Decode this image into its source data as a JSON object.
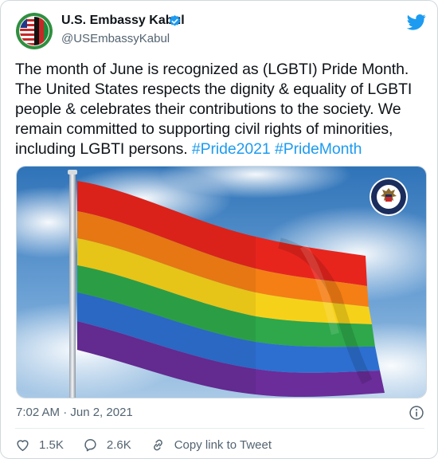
{
  "tweet": {
    "author_name": "U.S. Embassy Kabul",
    "author_handle": "@USEmbassyKabul",
    "text_main": "The month of June is recognized as (LGBTI) Pride Month. The United States respects the dignity & equality of LGBTI people & celebrates their contributions to the society. We remain committed to supporting civil rights of minorities, including LGBTI persons.",
    "hashtag_1": "#Pride2021",
    "hashtag_2": "#PrideMonth",
    "timestamp": "7:02 AM · Jun 2, 2021",
    "likes": "1.5K",
    "replies": "2.6K",
    "share_label": "Copy link to Tweet"
  },
  "icons": {
    "verified": "verified-badge-icon",
    "logo": "twitter-bird-icon",
    "info": "info-icon",
    "like": "heart-icon",
    "reply": "comment-bubble-icon",
    "share": "link-icon"
  },
  "colors": {
    "accent": "#1d9bf0",
    "text": "#0f1419",
    "muted": "#536471",
    "flag_red": "#e8251d",
    "flag_orange": "#f57f15",
    "flag_yellow": "#f6d11a",
    "flag_green": "#2ea84a",
    "flag_blue": "#2d6fd0",
    "flag_violet": "#6a2d9a"
  }
}
